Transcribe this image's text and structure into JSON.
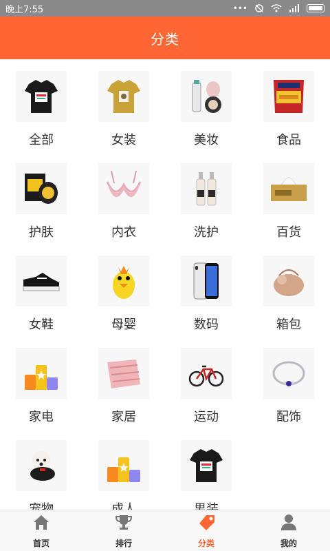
{
  "status_bar": {
    "time": "晚上7:55",
    "icons": [
      "more-dots-icon",
      "alarm-off-icon",
      "wifi-icon",
      "signal-icon",
      "battery-icon"
    ]
  },
  "header": {
    "title": "分类"
  },
  "colors": {
    "accent": "#ff6633",
    "text": "#333333",
    "tab_inactive": "#777777"
  },
  "categories": [
    {
      "label": "全部",
      "icon": "tshirt-black-icon"
    },
    {
      "label": "女装",
      "icon": "tshirt-mustard-icon"
    },
    {
      "label": "美妆",
      "icon": "cosmetics-icon"
    },
    {
      "label": "食品",
      "icon": "snack-bag-icon"
    },
    {
      "label": "护肤",
      "icon": "skincare-mask-icon"
    },
    {
      "label": "内衣",
      "icon": "bra-icon"
    },
    {
      "label": "洗护",
      "icon": "shampoo-bottles-icon"
    },
    {
      "label": "百货",
      "icon": "tissue-box-icon"
    },
    {
      "label": "女鞋",
      "icon": "sneaker-icon"
    },
    {
      "label": "母婴",
      "icon": "duck-bottle-icon"
    },
    {
      "label": "数码",
      "icon": "smartphone-icon"
    },
    {
      "label": "箱包",
      "icon": "fur-bag-icon"
    },
    {
      "label": "家电",
      "icon": "podium-blocks-icon"
    },
    {
      "label": "家居",
      "icon": "comforter-icon"
    },
    {
      "label": "运动",
      "icon": "bicycle-icon"
    },
    {
      "label": "配饰",
      "icon": "bracelet-icon"
    },
    {
      "label": "宠物",
      "icon": "dog-icon"
    },
    {
      "label": "成人",
      "icon": "podium-blocks-icon"
    },
    {
      "label": "男装",
      "icon": "tshirt-black-icon"
    }
  ],
  "tabs": [
    {
      "label": "首页",
      "icon": "home-icon",
      "active": false
    },
    {
      "label": "排行",
      "icon": "trophy-icon",
      "active": false
    },
    {
      "label": "分类",
      "icon": "tag-icon",
      "active": true
    },
    {
      "label": "我的",
      "icon": "user-icon",
      "active": false
    }
  ]
}
